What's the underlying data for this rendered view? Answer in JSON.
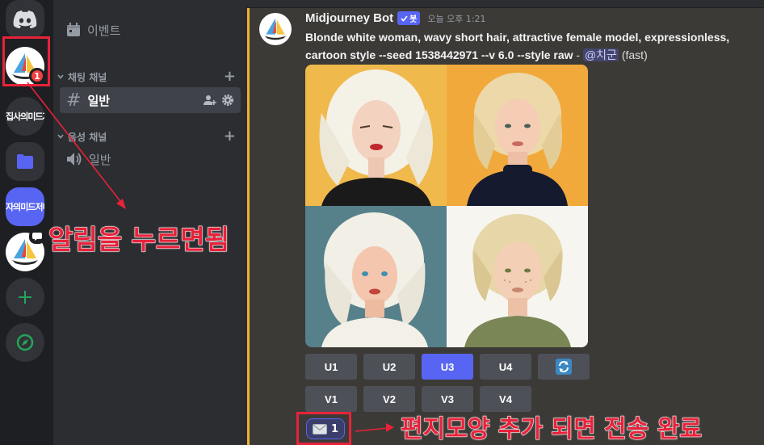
{
  "rail": {
    "server_abbrevs": [
      "집사의미드저",
      "자의미드저니"
    ],
    "mention_badge": "1"
  },
  "sidebar": {
    "event_label": "이벤트",
    "text_category": "채팅 채널",
    "voice_category": "음성 채널",
    "text_channel": "일반",
    "voice_channel": "일반"
  },
  "message": {
    "author": "Midjourney Bot",
    "bot_tag": "봇",
    "timestamp": "오늘 오후 1:21",
    "prompt": "Blonde white woman, wavy short hair, attractive female model, expressionless, cartoon style --seed 1538442971 --v 6.0 --style raw",
    "separator": " - ",
    "mention": "@치군",
    "mode": "(fast)"
  },
  "buttons": {
    "upscale": [
      "U1",
      "U2",
      "U3",
      "U4"
    ],
    "variation": [
      "V1",
      "V2",
      "V3",
      "V4"
    ],
    "selected": "U3",
    "reroll": "reroll-icon"
  },
  "reaction": {
    "emoji": "envelope-icon",
    "count": "1"
  },
  "annotations": {
    "notify": "알림을 누르면됨",
    "envelope": "편지모양 추가 되면 전송 완료"
  },
  "colors": {
    "accent": "#5865f2",
    "highlight": "#f0b232",
    "annotation": "#e8223a"
  }
}
